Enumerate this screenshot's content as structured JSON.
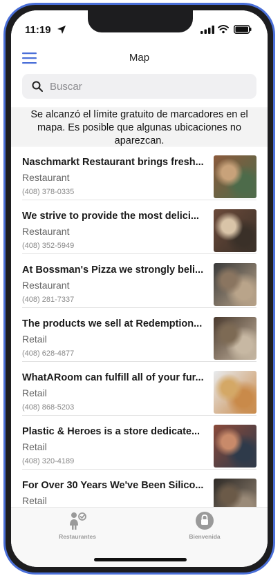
{
  "status_bar": {
    "time": "11:19"
  },
  "nav": {
    "title": "Map"
  },
  "search": {
    "placeholder": "Buscar",
    "value": ""
  },
  "notice": {
    "text": "Se alcanzó el límite gratuito de marcadores en el mapa. Es posible que algunas ubicaciones no aparezcan."
  },
  "listings": [
    {
      "title": "Naschmarkt Restaurant brings fresh...",
      "category": "Restaurant",
      "phone": "(408) 378-0335",
      "thumb_colors": [
        "#8b5a3c",
        "#c8a27a",
        "#4d6b4a"
      ]
    },
    {
      "title": "We strive to provide the most delici...",
      "category": "Restaurant",
      "phone": "(408) 352-5949",
      "thumb_colors": [
        "#6b4a3a",
        "#d9c4a8",
        "#3a3028"
      ]
    },
    {
      "title": "At Bossman's Pizza we strongly beli...",
      "category": "Restaurant",
      "phone": "(408) 281-7337",
      "thumb_colors": [
        "#3a3a3a",
        "#8a7560",
        "#b9a48a"
      ]
    },
    {
      "title": "The products we sell at Redemption...",
      "category": "Retail",
      "phone": "(408) 628-4877",
      "thumb_colors": [
        "#4a3a2e",
        "#7d6a54",
        "#c7b8a3"
      ]
    },
    {
      "title": "WhatARoom can fulfill all of your fur...",
      "category": "Retail",
      "phone": "(408) 868-5203",
      "thumb_colors": [
        "#e8ebee",
        "#d4a866",
        "#c98a4a"
      ]
    },
    {
      "title": "Plastic & Heroes is a store dedicate...",
      "category": "Retail",
      "phone": "(408) 320-4189",
      "thumb_colors": [
        "#8a4a3a",
        "#c88a6a",
        "#2e3a4a"
      ]
    },
    {
      "title": "For Over 30 Years We've Been Silico...",
      "category": "Retail",
      "phone": "",
      "thumb_colors": [
        "#2e2a26",
        "#6b5a48",
        "#9a8a78"
      ]
    }
  ],
  "tabs": [
    {
      "label": "Restaurantes",
      "icon": "restaurant-person-icon"
    },
    {
      "label": "Bienvenida",
      "icon": "lock-icon"
    }
  ],
  "colors": {
    "accent": "#4a6fd8",
    "frame": "#4a6fd8"
  }
}
